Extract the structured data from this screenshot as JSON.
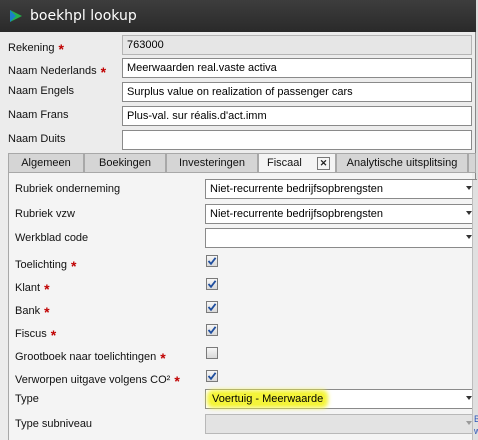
{
  "window": {
    "title": "boekhpl lookup"
  },
  "form": {
    "rekening": {
      "label": "Rekening",
      "required": "*",
      "value": "763000"
    },
    "naam_nl": {
      "label": "Naam Nederlands",
      "required": "*",
      "value": "Meerwaarden real.vaste activa"
    },
    "naam_en": {
      "label": "Naam Engels",
      "value": "Surplus value on realization of passenger cars"
    },
    "naam_fr": {
      "label": "Naam Frans",
      "value": "Plus-val. sur réalis.d'act.imm"
    },
    "naam_de": {
      "label": "Naam Duits",
      "value": ""
    }
  },
  "tabs": [
    {
      "label": "Algemeen"
    },
    {
      "label": "Boekingen"
    },
    {
      "label": "Investeringen"
    },
    {
      "label": "Fiscaal",
      "active": true
    },
    {
      "label": "Analytische uitsplitsing"
    }
  ],
  "tab_close": "✕",
  "fiscaal": {
    "rubriek_onderneming": {
      "label": "Rubriek onderneming",
      "value": "Niet-recurrente bedrijfsopbrengsten"
    },
    "rubriek_vzw": {
      "label": "Rubriek vzw",
      "value": "Niet-recurrente bedrijfsopbrengsten"
    },
    "werkblad_code": {
      "label": "Werkblad code",
      "value": ""
    },
    "toelichting": {
      "label": "Toelichting",
      "required": "*",
      "checked": true
    },
    "klant": {
      "label": "Klant",
      "required": "*",
      "checked": true
    },
    "bank": {
      "label": "Bank",
      "required": "*",
      "checked": true
    },
    "fiscus": {
      "label": "Fiscus",
      "required": "*",
      "checked": true
    },
    "grootboek": {
      "label": "Grootboek naar toelichtingen",
      "required": "*",
      "checked": false
    },
    "verworpen": {
      "label": "Verworpen uitgave volgens CO²",
      "required": "*",
      "checked": true
    },
    "type": {
      "label": "Type",
      "value": "Voertuig - Meerwaarde"
    },
    "type_subniveau": {
      "label": "Type subniveau",
      "value": ""
    }
  },
  "edge_links": {
    "b1": "B",
    "b2": "w"
  },
  "colors": {
    "titlebar": "#2f2f2f",
    "required": "#c00000",
    "highlight": "#f4f43a",
    "check": "#1f4e9e"
  }
}
